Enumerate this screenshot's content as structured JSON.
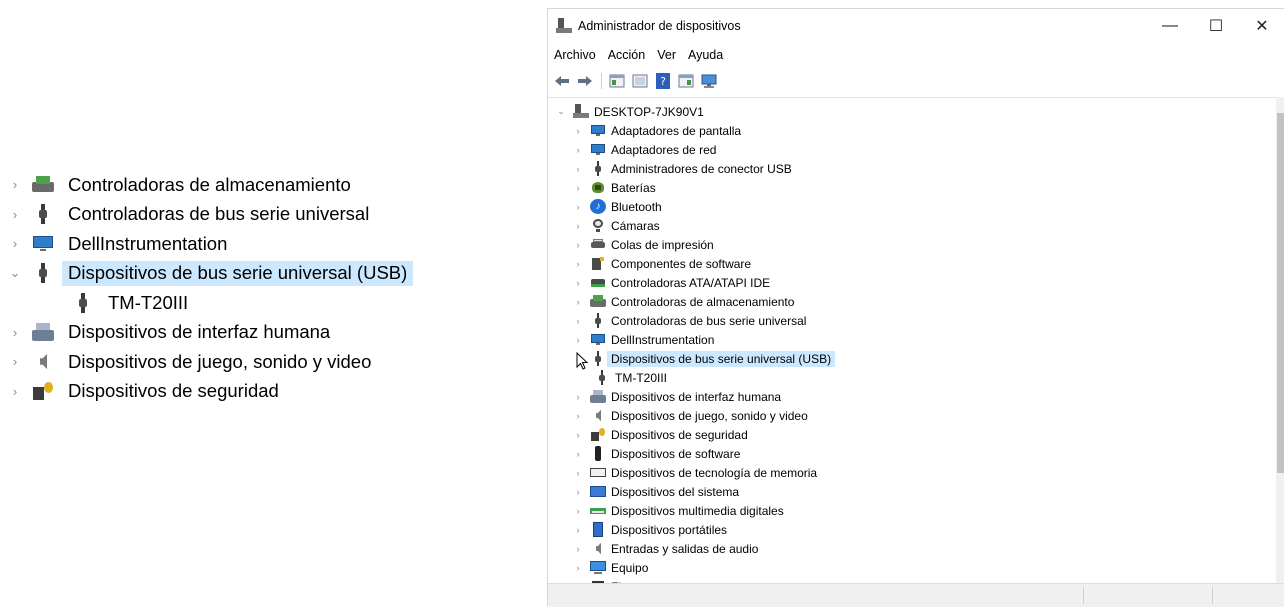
{
  "zoom": {
    "items": [
      {
        "label": "Controladoras de almacenamiento",
        "chevron": "›",
        "icon": "disk-icon",
        "selected": false,
        "child": false
      },
      {
        "label": "Controladoras de bus serie universal",
        "chevron": "›",
        "icon": "usb-icon",
        "selected": false,
        "child": false
      },
      {
        "label": "DellInstrumentation",
        "chevron": "›",
        "icon": "monitor-icon",
        "selected": false,
        "child": false
      },
      {
        "label": "Dispositivos de bus serie universal (USB)",
        "chevron": "⌄",
        "icon": "usb-icon",
        "selected": true,
        "child": false
      },
      {
        "label": "TM-T20III",
        "chevron": "",
        "icon": "usb-icon",
        "selected": false,
        "child": true
      },
      {
        "label": "Dispositivos de interfaz humana",
        "chevron": "›",
        "icon": "keyboard-icon",
        "selected": false,
        "child": false
      },
      {
        "label": "Dispositivos de juego, sonido y video",
        "chevron": "›",
        "icon": "speaker-icon",
        "selected": false,
        "child": false
      },
      {
        "label": "Dispositivos de seguridad",
        "chevron": "›",
        "icon": "lock-icon",
        "selected": false,
        "child": false
      }
    ]
  },
  "window": {
    "title": "Administrador de dispositivos",
    "controls": {
      "minimize": "—",
      "maximize": "☐",
      "close": "✕"
    },
    "menu": [
      "Archivo",
      "Acción",
      "Ver",
      "Ayuda"
    ],
    "toolbar": [
      {
        "name": "back-icon",
        "glyph": "⇦"
      },
      {
        "name": "forward-icon",
        "glyph": "⇨"
      },
      {
        "name": "properties-icon",
        "glyph": "▦"
      },
      {
        "name": "update-driver-icon",
        "glyph": "▤"
      },
      {
        "name": "help-icon",
        "glyph": "?"
      },
      {
        "name": "view-icon",
        "glyph": "▥"
      },
      {
        "name": "scan-hardware-icon",
        "glyph": "⊡"
      }
    ],
    "root": {
      "label": "DESKTOP-7JK90V1",
      "chevron": "⌄",
      "icon": "computer-icon"
    },
    "items": [
      {
        "label": "Adaptadores de pantalla",
        "icon": "monitor-icon",
        "cls": "monitor",
        "selected": false,
        "child": false
      },
      {
        "label": "Adaptadores de red",
        "icon": "network-icon",
        "cls": "monitor",
        "selected": false,
        "child": false
      },
      {
        "label": "Administradores de conector USB",
        "icon": "usb-icon",
        "cls": "usb",
        "selected": false,
        "child": false
      },
      {
        "label": "Baterías",
        "icon": "battery-icon",
        "cls": "battery",
        "selected": false,
        "child": false
      },
      {
        "label": "Bluetooth",
        "icon": "bluetooth-icon",
        "cls": "bt",
        "selected": false,
        "child": false
      },
      {
        "label": "Cámaras",
        "icon": "camera-icon",
        "cls": "camera",
        "selected": false,
        "child": false
      },
      {
        "label": "Colas de impresión",
        "icon": "printer-icon",
        "cls": "printer",
        "selected": false,
        "child": false
      },
      {
        "label": "Componentes de software",
        "icon": "software-component-icon",
        "cls": "component",
        "selected": false,
        "child": false
      },
      {
        "label": "Controladoras ATA/ATAPI IDE",
        "icon": "ata-controller-icon",
        "cls": "ata",
        "selected": false,
        "child": false
      },
      {
        "label": "Controladoras de almacenamiento",
        "icon": "disk-icon",
        "cls": "disk",
        "selected": false,
        "child": false
      },
      {
        "label": "Controladoras de bus serie universal",
        "icon": "usb-icon",
        "cls": "usb",
        "selected": false,
        "child": false
      },
      {
        "label": "DellInstrumentation",
        "icon": "monitor-icon",
        "cls": "monitor",
        "selected": false,
        "child": false
      },
      {
        "label": "Dispositivos de bus serie universal (USB)",
        "icon": "usb-icon",
        "cls": "usb",
        "selected": true,
        "child": false
      },
      {
        "label": "TM-T20III",
        "icon": "usb-icon",
        "cls": "usb",
        "selected": false,
        "child": true
      },
      {
        "label": "Dispositivos de interfaz humana",
        "icon": "keyboard-icon",
        "cls": "kbd",
        "selected": false,
        "child": false
      },
      {
        "label": "Dispositivos de juego, sonido y video",
        "icon": "speaker-icon",
        "cls": "speaker",
        "selected": false,
        "child": false
      },
      {
        "label": "Dispositivos de seguridad",
        "icon": "lock-icon",
        "cls": "lock",
        "selected": false,
        "child": false
      },
      {
        "label": "Dispositivos de software",
        "icon": "phone-icon",
        "cls": "phone",
        "selected": false,
        "child": false
      },
      {
        "label": "Dispositivos de tecnología de memoria",
        "icon": "memory-icon",
        "cls": "memory",
        "selected": false,
        "child": false
      },
      {
        "label": "Dispositivos del sistema",
        "icon": "system-icon",
        "cls": "system",
        "selected": false,
        "child": false
      },
      {
        "label": "Dispositivos multimedia digitales",
        "icon": "multimedia-icon",
        "cls": "mm",
        "selected": false,
        "child": false
      },
      {
        "label": "Dispositivos portátiles",
        "icon": "portable-device-icon",
        "cls": "portable",
        "selected": false,
        "child": false
      },
      {
        "label": "Entradas y salidas de audio",
        "icon": "speaker-icon",
        "cls": "speaker",
        "selected": false,
        "child": false
      },
      {
        "label": "Equipo",
        "icon": "monitor-icon",
        "cls": "equipo",
        "selected": false,
        "child": false
      },
      {
        "label": "Firmware",
        "icon": "firmware-icon",
        "cls": "firmware",
        "selected": false,
        "child": false
      }
    ],
    "collapsed_chevron": "›"
  },
  "colors": {
    "selection": "#cce8ff",
    "chevron": "#8a8a8a",
    "statusbar": "#f0f0f0"
  }
}
